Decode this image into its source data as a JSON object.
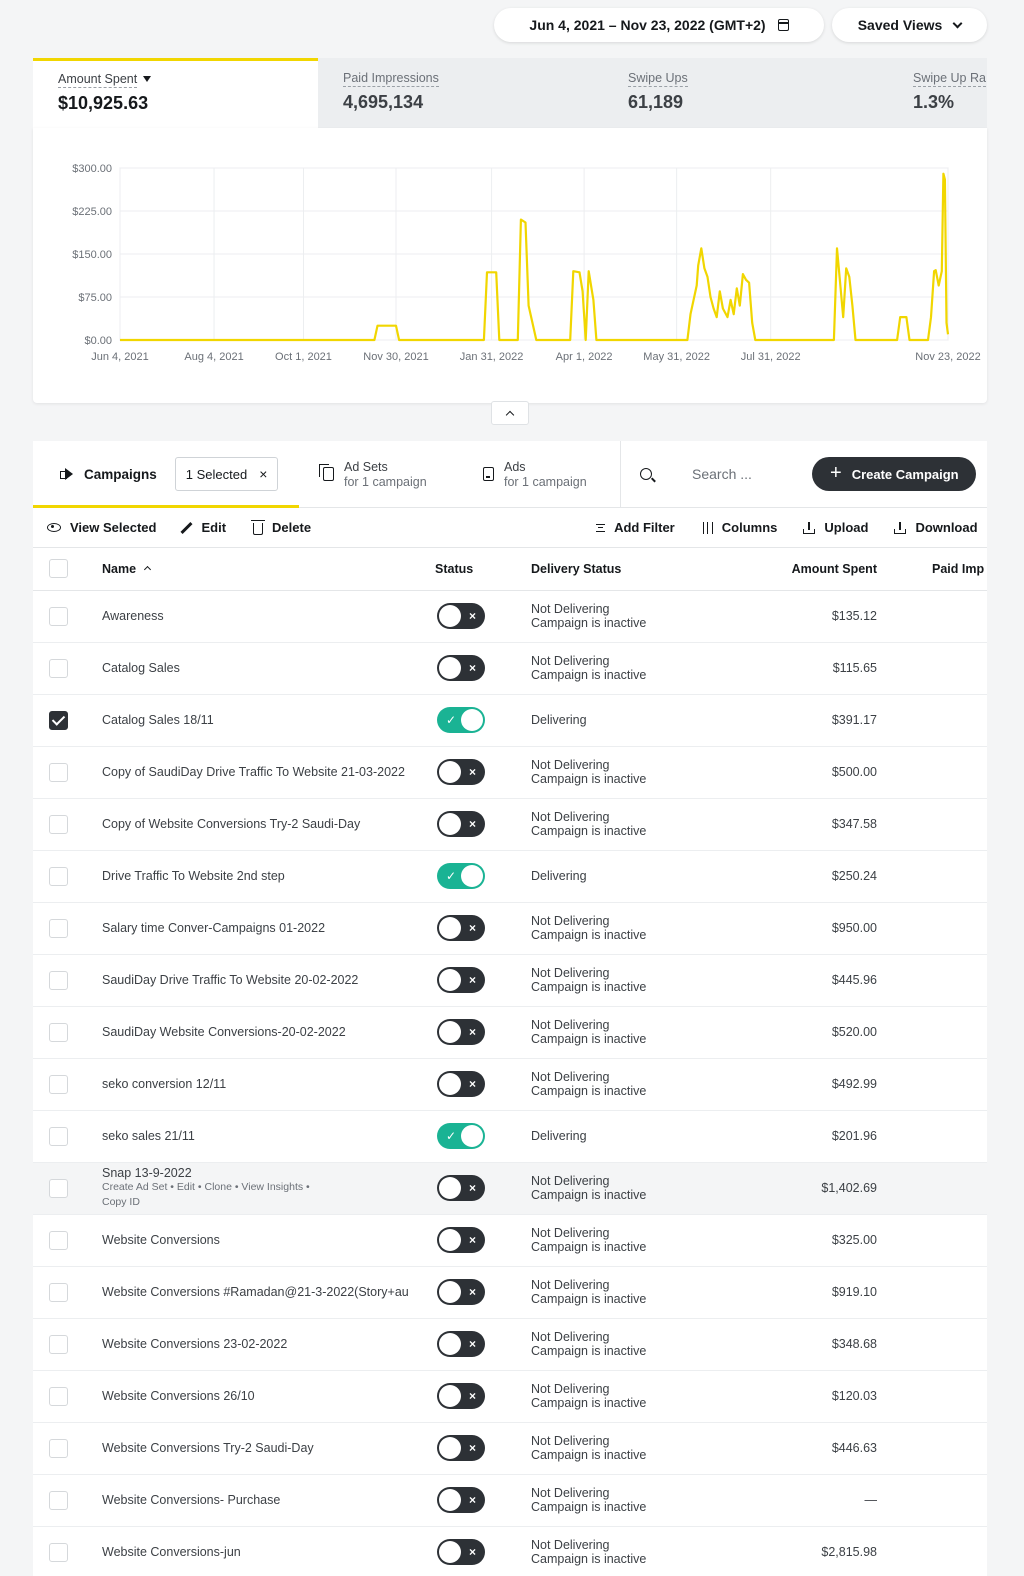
{
  "header": {
    "date_range": "Jun 4, 2021 – Nov 23, 2022 (GMT+2)",
    "saved_views": "Saved Views"
  },
  "metrics": [
    {
      "label": "Amount Spent",
      "value": "$10,925.63"
    },
    {
      "label": "Paid Impressions",
      "value": "4,695,134"
    },
    {
      "label": "Swipe Ups",
      "value": "61,189"
    },
    {
      "label": "Swipe Up Ra",
      "value": "1.3%"
    }
  ],
  "chart_data": {
    "type": "line",
    "title": "",
    "xlabel": "",
    "ylabel": "",
    "color": "#f1d600",
    "ylim": [
      0,
      300
    ],
    "yticks": [
      "$300.00",
      "$225.00",
      "$150.00",
      "$75.00",
      "$0.00"
    ],
    "ytick_values": [
      300,
      225,
      150,
      75,
      0
    ],
    "xticks": [
      "Jun 4, 2021",
      "Aug 4, 2021",
      "Oct 1, 2021",
      "Nov 30, 2021",
      "Jan 31, 2022",
      "Apr 1, 2022",
      "May 31, 2022",
      "Jul 31, 2022",
      "Nov 23, 2022"
    ],
    "xtick_days": [
      0,
      61,
      119,
      179,
      241,
      301,
      361,
      422,
      537
    ],
    "xlim_days": [
      0,
      537
    ],
    "grid": true,
    "series": [
      {
        "x_days": [
          0,
          165,
          167,
          179,
          181,
          236,
          238,
          244,
          246,
          258,
          260,
          263,
          265,
          270,
          272,
          292,
          294,
          298,
          300,
          302,
          304,
          307,
          309,
          368,
          370,
          374,
          375,
          377,
          379,
          381,
          383,
          385,
          387,
          389,
          391,
          394,
          396,
          398,
          400,
          402,
          404,
          406,
          408,
          410,
          412,
          419,
          421,
          463,
          465,
          467,
          469,
          471,
          473,
          475,
          477,
          504,
          506,
          510,
          512,
          524,
          526,
          528,
          529,
          531,
          533,
          534,
          535,
          536,
          537
        ],
        "values": [
          0,
          0,
          25,
          25,
          0,
          0,
          118,
          118,
          0,
          0,
          210,
          205,
          60,
          0,
          0,
          0,
          120,
          118,
          85,
          0,
          120,
          70,
          0,
          0,
          45,
          95,
          130,
          160,
          125,
          110,
          75,
          55,
          40,
          85,
          55,
          40,
          70,
          45,
          90,
          60,
          115,
          105,
          100,
          30,
          0,
          0,
          0,
          0,
          160,
          100,
          40,
          125,
          110,
          60,
          0,
          0,
          40,
          40,
          0,
          0,
          40,
          120,
          122,
          95,
          120,
          290,
          280,
          30,
          10
        ]
      }
    ]
  },
  "tabs": {
    "campaigns": "Campaigns",
    "selected_chip": "1 Selected",
    "chip_close": "×",
    "adsets_title": "Ad Sets",
    "adsets_sub": "for 1 campaign",
    "ads_title": "Ads",
    "ads_sub": "for 1 campaign",
    "search_placeholder": "Search ...",
    "create": "Create Campaign"
  },
  "toolbar": {
    "view_selected": "View Selected",
    "edit": "Edit",
    "delete": "Delete",
    "add_filter": "Add Filter",
    "columns": "Columns",
    "upload": "Upload",
    "download": "Download"
  },
  "table": {
    "columns": {
      "name": "Name",
      "status": "Status",
      "delivery": "Delivery Status",
      "amount": "Amount Spent",
      "impressions": "Paid Imp"
    },
    "rows": [
      {
        "name": "Awareness",
        "active": false,
        "checked": false,
        "delivery": "Not Delivering",
        "delivery_sub": "Campaign is inactive",
        "amount": "$135.12"
      },
      {
        "name": "Catalog Sales",
        "active": false,
        "checked": false,
        "delivery": "Not Delivering",
        "delivery_sub": "Campaign is inactive",
        "amount": "$115.65"
      },
      {
        "name": "Catalog Sales 18/11",
        "active": true,
        "checked": true,
        "delivery": "Delivering",
        "delivery_sub": "",
        "amount": "$391.17"
      },
      {
        "name": "Copy of SaudiDay Drive Traffic To Website 21-03-2022",
        "active": false,
        "checked": false,
        "delivery": "Not Delivering",
        "delivery_sub": "Campaign is inactive",
        "amount": "$500.00"
      },
      {
        "name": "Copy of Website Conversions Try-2 Saudi-Day",
        "active": false,
        "checked": false,
        "delivery": "Not Delivering",
        "delivery_sub": "Campaign is inactive",
        "amount": "$347.58"
      },
      {
        "name": "Drive Traffic To Website 2nd step",
        "active": true,
        "checked": false,
        "delivery": "Delivering",
        "delivery_sub": "",
        "amount": "$250.24"
      },
      {
        "name": "Salary time Conver-Campaigns 01-2022",
        "active": false,
        "checked": false,
        "delivery": "Not Delivering",
        "delivery_sub": "Campaign is inactive",
        "amount": "$950.00"
      },
      {
        "name": "SaudiDay Drive Traffic To Website 20-02-2022",
        "active": false,
        "checked": false,
        "delivery": "Not Delivering",
        "delivery_sub": "Campaign is inactive",
        "amount": "$445.96"
      },
      {
        "name": "SaudiDay Website Conversions-20-02-2022",
        "active": false,
        "checked": false,
        "delivery": "Not Delivering",
        "delivery_sub": "Campaign is inactive",
        "amount": "$520.00"
      },
      {
        "name": "seko conversion 12/11",
        "active": false,
        "checked": false,
        "delivery": "Not Delivering",
        "delivery_sub": "Campaign is inactive",
        "amount": "$492.99"
      },
      {
        "name": "seko sales 21/11",
        "active": true,
        "checked": false,
        "delivery": "Delivering",
        "delivery_sub": "",
        "amount": "$201.96"
      },
      {
        "name": "Snap 13-9-2022",
        "active": false,
        "checked": false,
        "delivery": "Not Delivering",
        "delivery_sub": "Campaign is inactive",
        "amount": "$1,402.69",
        "hover": true,
        "actions": "Create Ad Set  •  Edit  •  Clone  •  View Insights  •",
        "actions2": "Copy ID"
      },
      {
        "name": "Website Conversions",
        "active": false,
        "checked": false,
        "delivery": "Not Delivering",
        "delivery_sub": "Campaign is inactive",
        "amount": "$325.00"
      },
      {
        "name": "Website Conversions #Ramadan@21-3-2022(Story+au",
        "active": false,
        "checked": false,
        "delivery": "Not Delivering",
        "delivery_sub": "Campaign is inactive",
        "amount": "$919.10"
      },
      {
        "name": "Website Conversions 23-02-2022",
        "active": false,
        "checked": false,
        "delivery": "Not Delivering",
        "delivery_sub": "Campaign is inactive",
        "amount": "$348.68"
      },
      {
        "name": "Website Conversions 26/10",
        "active": false,
        "checked": false,
        "delivery": "Not Delivering",
        "delivery_sub": "Campaign is inactive",
        "amount": "$120.03"
      },
      {
        "name": "Website Conversions Try-2 Saudi-Day",
        "active": false,
        "checked": false,
        "delivery": "Not Delivering",
        "delivery_sub": "Campaign is inactive",
        "amount": "$446.63"
      },
      {
        "name": "Website Conversions- Purchase",
        "active": false,
        "checked": false,
        "delivery": "Not Delivering",
        "delivery_sub": "Campaign is inactive",
        "amount": "—"
      },
      {
        "name": "Website Conversions-jun",
        "active": false,
        "checked": false,
        "delivery": "Not Delivering",
        "delivery_sub": "Campaign is inactive",
        "amount": "$2,815.98"
      }
    ]
  }
}
